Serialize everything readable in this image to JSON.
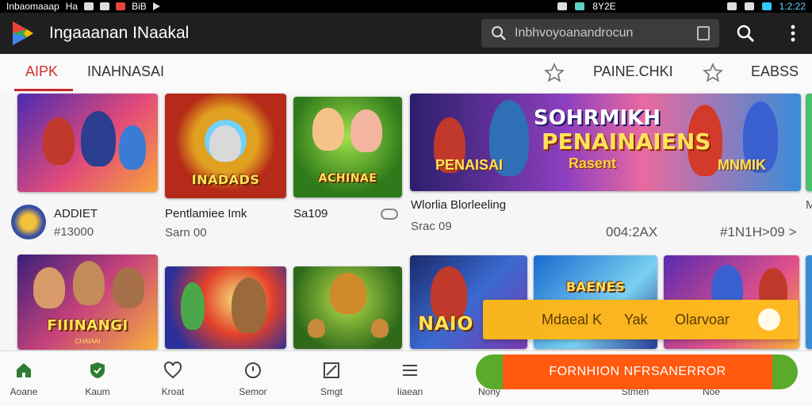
{
  "status_bar": {
    "left_text": "Inbaomaaap",
    "left_text_2": "Ha",
    "left_text_3": "BiB",
    "right_text": "8Y2E",
    "time": "1:2:22"
  },
  "app_bar": {
    "title": "Ingaaanan INaakal",
    "search_placeholder": "Inbhvoyoanandrocun"
  },
  "tabs": [
    {
      "label": "AIPK"
    },
    {
      "label": "INAHNASAI"
    },
    {
      "label": "PAINE.CHKI"
    },
    {
      "label": "EABSS"
    }
  ],
  "row1": [
    {
      "title": "",
      "meta_title": "ADDIET",
      "meta_sub": "#13000"
    },
    {
      "title": "INADADS",
      "meta_title": "Pentlamiee Imk",
      "meta_sub": "Sarn 00"
    },
    {
      "title": "ACHINAE",
      "meta_title": "Sa109",
      "meta_sub": ""
    },
    {
      "title": "PENAINAIENS",
      "banner_top": "SOHRMIKH",
      "banner_sub": "Rasent",
      "banner_left": "PENAISAI",
      "banner_right": "MNMIK",
      "meta_title": "Wlorlia Blorleeling",
      "meta_sub": "Srac 09",
      "meta_mid": "004:2AX",
      "meta_right": "#1N1H>09 >",
      "meta_far": "M"
    }
  ],
  "row2": [
    {
      "title": "FIIINANGI",
      "subtitle": "CHAIAAI"
    },
    {
      "title": ""
    },
    {
      "title": ""
    },
    {
      "title": "NAIO"
    },
    {
      "title": "BAENES"
    },
    {
      "title": ""
    }
  ],
  "toast": {
    "text_1": "Mdaeal K",
    "text_2": "Yak",
    "text_3": "Olarvoar"
  },
  "banner": {
    "label": "FORNHION NFRSANERROR"
  },
  "bottom_nav": [
    {
      "label": "Aoane",
      "icon": "home-icon"
    },
    {
      "label": "Kaum",
      "icon": "shield-icon"
    },
    {
      "label": "Kroat",
      "icon": "heart-icon"
    },
    {
      "label": "Semor",
      "icon": "clock-icon"
    },
    {
      "label": "Smgt",
      "icon": "image-icon"
    },
    {
      "label": "Iiaean",
      "icon": "menu-icon"
    },
    {
      "label": "Nony",
      "icon": "chevron-down-icon"
    },
    {
      "label": "Stmen",
      "icon": "star-icon"
    },
    {
      "label": "Noe",
      "icon": "check-icon"
    }
  ],
  "colors": {
    "accent": "#d32f2f",
    "appbar": "#1f1f1f",
    "nav_active": "#2e7d32",
    "toast": "#f7b51d",
    "banner": "#ff5a10"
  }
}
